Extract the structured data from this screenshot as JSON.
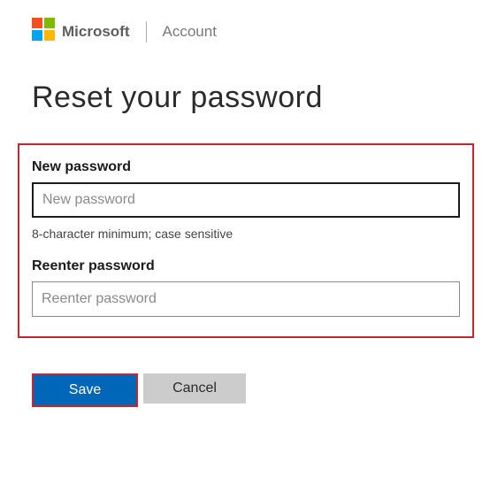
{
  "header": {
    "brand": "Microsoft",
    "section": "Account"
  },
  "page": {
    "title": "Reset your password"
  },
  "form": {
    "new_password": {
      "label": "New password",
      "placeholder": "New password",
      "value": ""
    },
    "hint": "8-character minimum; case sensitive",
    "reenter_password": {
      "label": "Reenter password",
      "placeholder": "Reenter password",
      "value": ""
    }
  },
  "buttons": {
    "save": "Save",
    "cancel": "Cancel"
  },
  "colors": {
    "highlight": "#c1272d",
    "primary": "#0067b8"
  }
}
